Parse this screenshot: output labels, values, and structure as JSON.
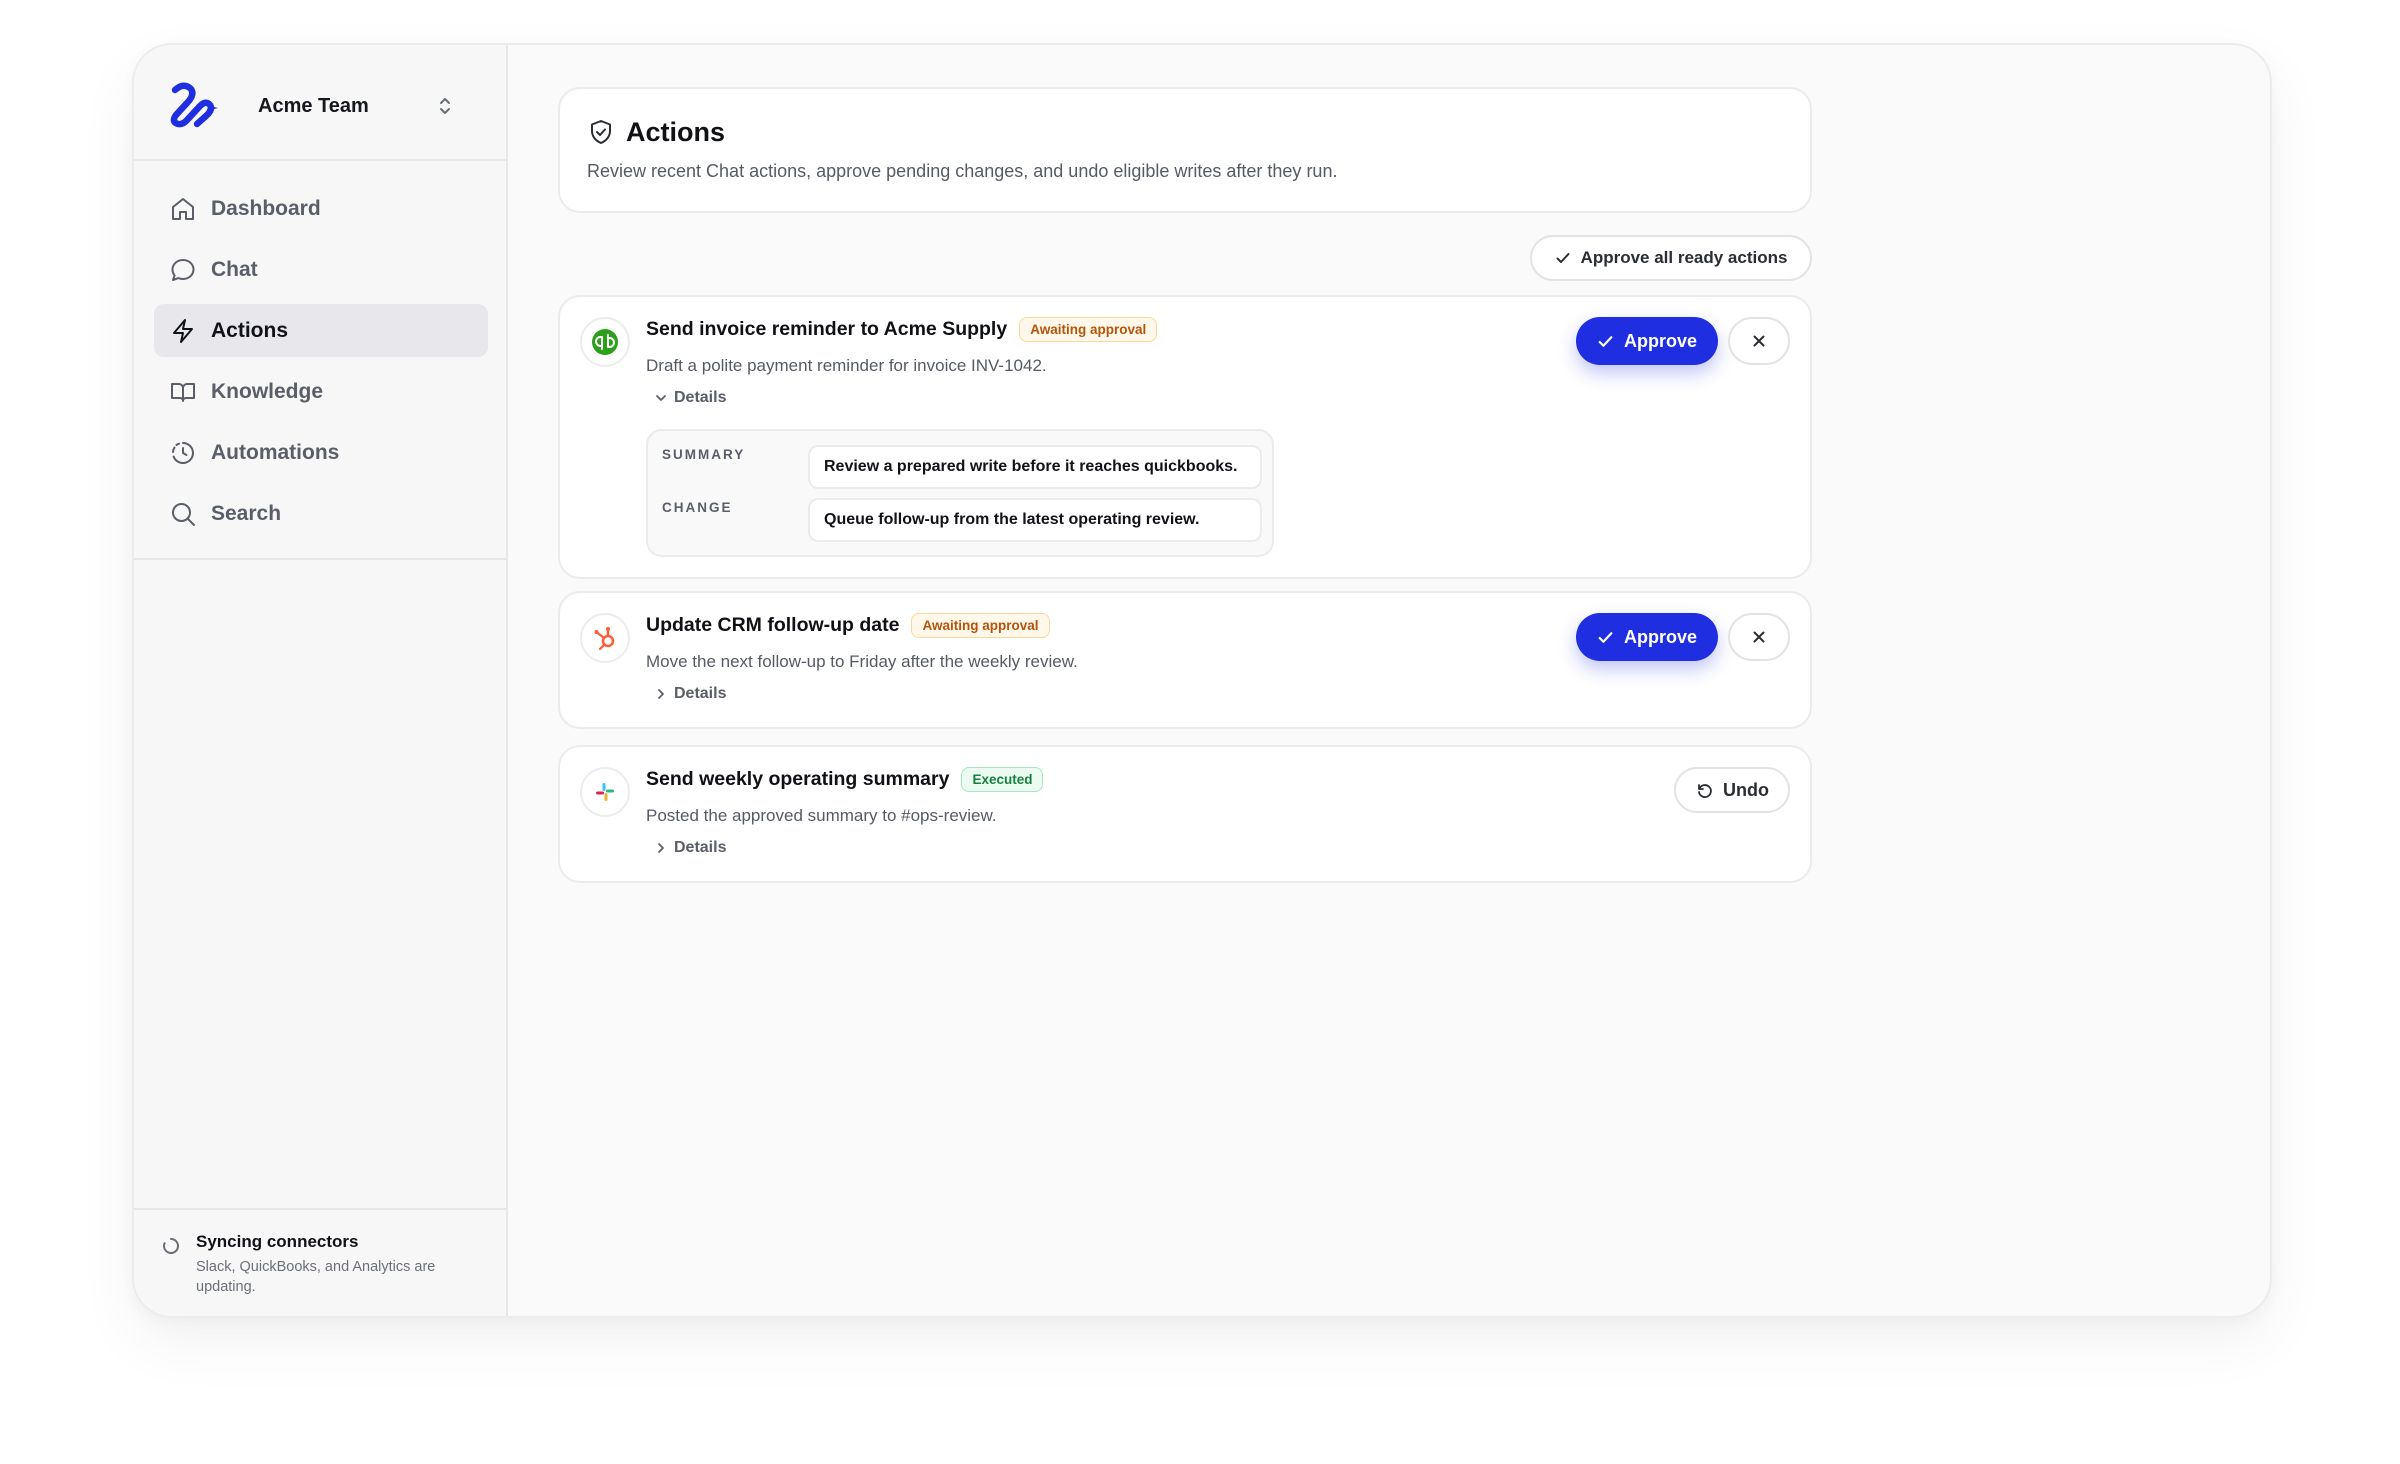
{
  "sidebar": {
    "team_name": "Acme Team",
    "items": [
      {
        "label": "Dashboard",
        "icon": "home-icon"
      },
      {
        "label": "Chat",
        "icon": "chat-bubble-icon"
      },
      {
        "label": "Actions",
        "icon": "lightning-icon",
        "active": true
      },
      {
        "label": "Knowledge",
        "icon": "book-icon"
      },
      {
        "label": "Automations",
        "icon": "clock-history-icon"
      },
      {
        "label": "Search",
        "icon": "search-icon"
      }
    ],
    "sync": {
      "title": "Syncing connectors",
      "description": "Slack, QuickBooks, and Analytics are updating."
    }
  },
  "header": {
    "title": "Actions",
    "description": "Review recent Chat actions, approve pending changes, and undo eligible writes after they run."
  },
  "toolbar": {
    "approve_all_label": "Approve all ready actions"
  },
  "actions": [
    {
      "title": "Send invoice reminder to Acme Supply",
      "status": "Awaiting approval",
      "description": "Draft a polite payment reminder for invoice INV-1042.",
      "details_label": "Details",
      "details_expanded": true,
      "summary_label": "SUMMARY",
      "summary_value": "Review a prepared write before it reaches quickbooks.",
      "change_label": "CHANGE",
      "change_value": "Queue follow-up from the latest operating review.",
      "approve_label": "Approve",
      "connector_icon": "quickbooks-icon"
    },
    {
      "title": "Update CRM follow-up date",
      "status": "Awaiting approval",
      "description": "Move the next follow-up to Friday after the weekly review.",
      "details_label": "Details",
      "details_expanded": false,
      "approve_label": "Approve",
      "connector_icon": "hubspot-icon"
    },
    {
      "title": "Send weekly operating summary",
      "status": "Executed",
      "description": "Posted the approved summary to #ops-review.",
      "details_label": "Details",
      "details_expanded": false,
      "undo_label": "Undo",
      "connector_icon": "slack-icon"
    }
  ],
  "colors": {
    "accent": "#1f2ee0",
    "awaiting": "#b45309",
    "executed": "#15803d"
  }
}
